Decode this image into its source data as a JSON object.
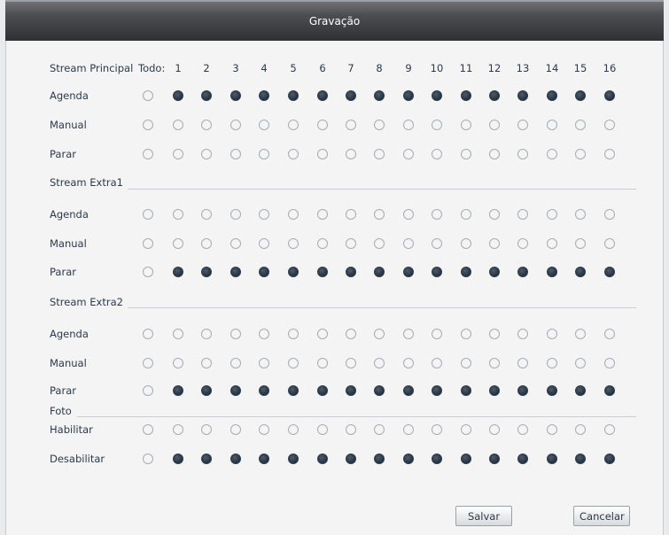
{
  "window": {
    "title": "Gravação"
  },
  "header": {
    "section": "Stream Principal",
    "all_label": "Todo:",
    "channels": [
      "1",
      "2",
      "3",
      "4",
      "5",
      "6",
      "7",
      "8",
      "9",
      "10",
      "11",
      "12",
      "13",
      "14",
      "15",
      "16"
    ]
  },
  "groups": [
    {
      "id": "main",
      "title": "",
      "rows": [
        {
          "label": "Agenda",
          "all": false,
          "channels": [
            true,
            true,
            true,
            true,
            true,
            true,
            true,
            true,
            true,
            true,
            true,
            true,
            true,
            true,
            true,
            true
          ]
        },
        {
          "label": "Manual",
          "all": false,
          "channels": [
            false,
            false,
            false,
            false,
            false,
            false,
            false,
            false,
            false,
            false,
            false,
            false,
            false,
            false,
            false,
            false
          ]
        },
        {
          "label": "Parar",
          "all": false,
          "channels": [
            false,
            false,
            false,
            false,
            false,
            false,
            false,
            false,
            false,
            false,
            false,
            false,
            false,
            false,
            false,
            false
          ]
        }
      ]
    },
    {
      "id": "extra1",
      "title": "Stream Extra1",
      "rows": [
        {
          "label": "Agenda",
          "all": false,
          "channels": [
            false,
            false,
            false,
            false,
            false,
            false,
            false,
            false,
            false,
            false,
            false,
            false,
            false,
            false,
            false,
            false
          ]
        },
        {
          "label": "Manual",
          "all": false,
          "channels": [
            false,
            false,
            false,
            false,
            false,
            false,
            false,
            false,
            false,
            false,
            false,
            false,
            false,
            false,
            false,
            false
          ]
        },
        {
          "label": "Parar",
          "all": false,
          "channels": [
            true,
            true,
            true,
            true,
            true,
            true,
            true,
            true,
            true,
            true,
            true,
            true,
            true,
            true,
            true,
            true
          ]
        }
      ]
    },
    {
      "id": "extra2",
      "title": "Stream Extra2",
      "rows": [
        {
          "label": "Agenda",
          "all": false,
          "channels": [
            false,
            false,
            false,
            false,
            false,
            false,
            false,
            false,
            false,
            false,
            false,
            false,
            false,
            false,
            false,
            false
          ]
        },
        {
          "label": "Manual",
          "all": false,
          "channels": [
            false,
            false,
            false,
            false,
            false,
            false,
            false,
            false,
            false,
            false,
            false,
            false,
            false,
            false,
            false,
            false
          ]
        },
        {
          "label": "Parar",
          "all": false,
          "channels": [
            true,
            true,
            true,
            true,
            true,
            true,
            true,
            true,
            true,
            true,
            true,
            true,
            true,
            true,
            true,
            true
          ]
        }
      ]
    },
    {
      "id": "foto",
      "title": "Foto",
      "rows": [
        {
          "label": "Habilitar",
          "all": false,
          "channels": [
            false,
            false,
            false,
            false,
            false,
            false,
            false,
            false,
            false,
            false,
            false,
            false,
            false,
            false,
            false,
            false
          ]
        },
        {
          "label": "Desabilitar",
          "all": false,
          "channels": [
            true,
            true,
            true,
            true,
            true,
            true,
            true,
            true,
            true,
            true,
            true,
            true,
            true,
            true,
            true,
            true
          ]
        }
      ]
    }
  ],
  "buttons": {
    "save": "Salvar",
    "cancel": "Cancelar"
  },
  "colors": {
    "selected": "#26313d",
    "unselected_border": "#a7acb2",
    "title_bar": "#3a3c3f"
  }
}
